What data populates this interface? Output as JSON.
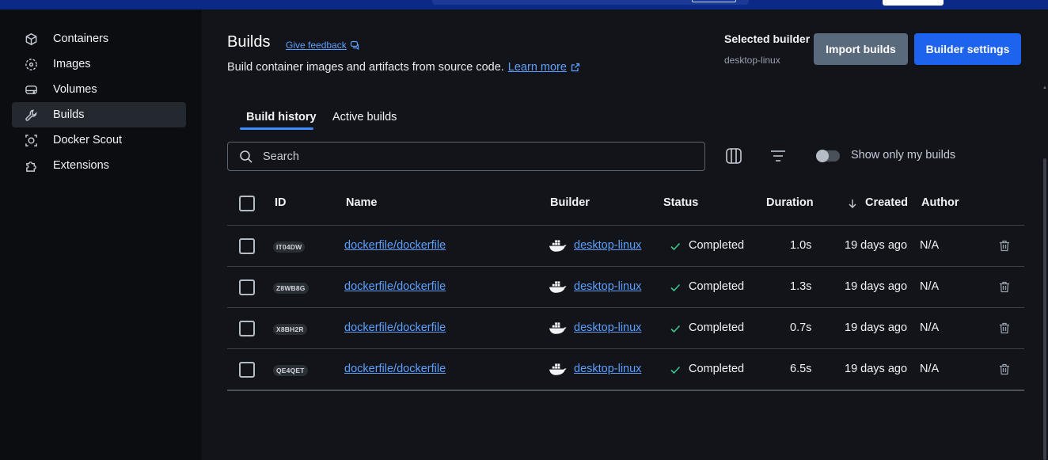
{
  "sidebar": {
    "items": [
      {
        "label": "Containers",
        "icon": "cube-icon",
        "active": false
      },
      {
        "label": "Images",
        "icon": "images-icon",
        "active": false
      },
      {
        "label": "Volumes",
        "icon": "volume-icon",
        "active": false
      },
      {
        "label": "Builds",
        "icon": "wrench-icon",
        "active": true
      },
      {
        "label": "Docker Scout",
        "icon": "scout-icon",
        "active": false
      },
      {
        "label": "Extensions",
        "icon": "puzzle-icon",
        "active": false
      }
    ]
  },
  "header": {
    "title": "Builds",
    "feedback_label": "Give feedback",
    "subtitle": "Build container images and artifacts from source code.",
    "learn_more": "Learn more",
    "selected_builder_label": "Selected builder",
    "selected_builder_value": "desktop-linux",
    "import_button": "Import builds",
    "settings_button": "Builder settings"
  },
  "tabs": [
    {
      "label": "Build history",
      "active": true
    },
    {
      "label": "Active builds",
      "active": false
    }
  ],
  "toolbar": {
    "search_placeholder": "Search",
    "toggle_label": "Show only my builds",
    "toggle_on": false
  },
  "table": {
    "columns": [
      "ID",
      "Name",
      "Builder",
      "Status",
      "Duration",
      "Created",
      "Author"
    ],
    "rows": [
      {
        "id": "IT04DW",
        "name": "dockerfile/dockerfile",
        "builder": "desktop-linux",
        "status": "Completed",
        "duration": "1.0s",
        "created": "19 days ago",
        "author": "N/A"
      },
      {
        "id": "Z8WB8G",
        "name": "dockerfile/dockerfile",
        "builder": "desktop-linux",
        "status": "Completed",
        "duration": "1.3s",
        "created": "19 days ago",
        "author": "N/A"
      },
      {
        "id": "X8BH2R",
        "name": "dockerfile/dockerfile",
        "builder": "desktop-linux",
        "status": "Completed",
        "duration": "0.7s",
        "created": "19 days ago",
        "author": "N/A"
      },
      {
        "id": "QE4QET",
        "name": "dockerfile/dockerfile",
        "builder": "desktop-linux",
        "status": "Completed",
        "duration": "6.5s",
        "created": "19 days ago",
        "author": "N/A"
      }
    ]
  },
  "colors": {
    "accent": "#1d63ed",
    "link": "#5ca0ff",
    "success": "#3cc48c",
    "topbar": "#0b2a87"
  }
}
